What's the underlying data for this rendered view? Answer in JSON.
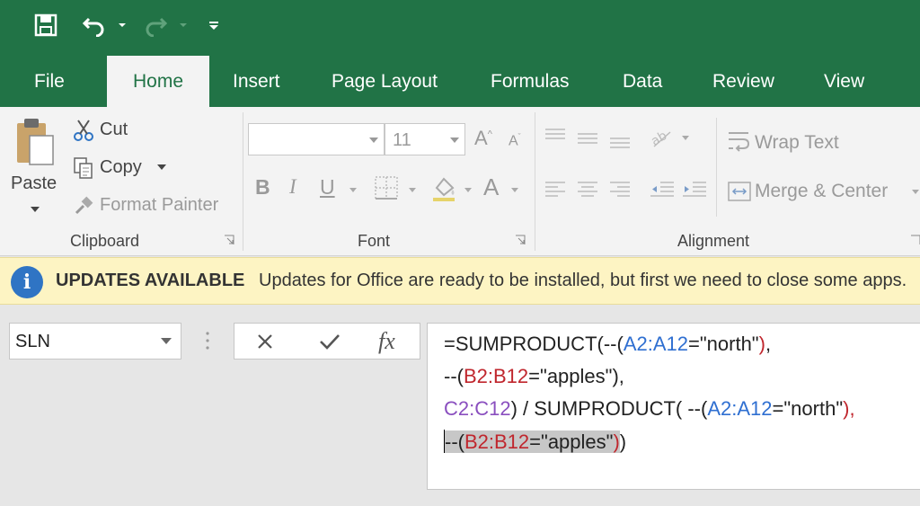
{
  "quick_access": {
    "save_icon": "save-icon",
    "undo_icon": "undo-icon",
    "redo_icon": "redo-icon",
    "customize_icon": "customize-quick-access-icon"
  },
  "tabs": [
    {
      "label": "File"
    },
    {
      "label": "Home",
      "active": true
    },
    {
      "label": "Insert"
    },
    {
      "label": "Page Layout"
    },
    {
      "label": "Formulas"
    },
    {
      "label": "Data"
    },
    {
      "label": "Review"
    },
    {
      "label": "View"
    }
  ],
  "clipboard": {
    "paste": "Paste",
    "cut": "Cut",
    "copy": "Copy",
    "format_painter": "Format Painter",
    "group_label": "Clipboard"
  },
  "font": {
    "font_name": "",
    "font_size": "11",
    "bold": "B",
    "italic": "I",
    "underline": "U",
    "font_color": "A",
    "group_label": "Font"
  },
  "alignment": {
    "wrap_text": "Wrap Text",
    "merge_center": "Merge & Center",
    "group_label": "Alignment"
  },
  "updates": {
    "title": "UPDATES AVAILABLE",
    "message": "Updates for Office are ready to be installed, but first we need to close some apps."
  },
  "name_box": {
    "value": "SLN"
  },
  "formula_buttons": {
    "fx_label": "fx"
  },
  "formula": {
    "line1": [
      {
        "t": "=SUMPRODUCT(--(",
        "c": ""
      },
      {
        "t": "A2:A12",
        "c": "blue"
      },
      {
        "t": "=\"north\"",
        "c": ""
      },
      {
        "t": ")",
        "c": "red"
      },
      {
        "t": ",",
        "c": ""
      }
    ],
    "line2": [
      {
        "t": "--(",
        "c": ""
      },
      {
        "t": "B2:B12",
        "c": "red"
      },
      {
        "t": "=\"apples\"",
        "c": ""
      },
      {
        "t": "),",
        "c": ""
      }
    ],
    "line3": [
      {
        "t": "C2:C12",
        "c": "purple"
      },
      {
        "t": ") / SUMPRODUCT( --(",
        "c": ""
      },
      {
        "t": "A2:A12",
        "c": "blue"
      },
      {
        "t": "=\"north\"",
        "c": ""
      },
      {
        "t": "),",
        "c": "red"
      }
    ],
    "line4": [
      {
        "t": "--(",
        "c": "",
        "sel": true
      },
      {
        "t": "B2:B12",
        "c": "red",
        "sel": true
      },
      {
        "t": "=\"apples\"",
        "c": "",
        "sel": true
      },
      {
        "t": ")",
        "c": "red",
        "sel": true
      },
      {
        "t": ")",
        "c": ""
      }
    ]
  },
  "colors": {
    "excel_green": "#217346",
    "ref_blue": "#2f6fd1",
    "ref_red": "#c0262d",
    "ref_purple": "#8a4fbf",
    "update_bar": "#fdf4c3"
  }
}
